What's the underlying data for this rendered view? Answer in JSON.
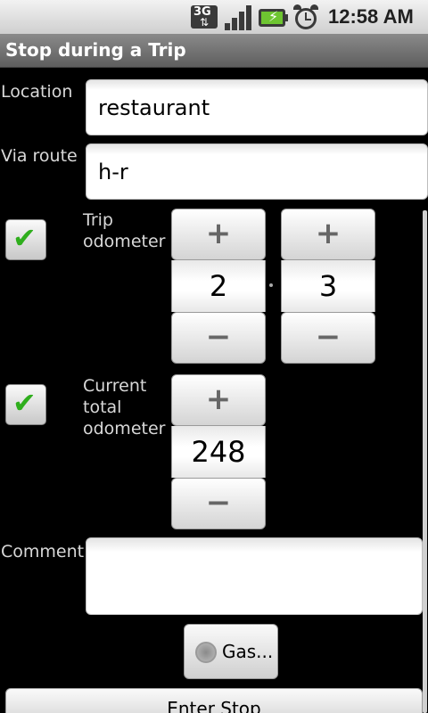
{
  "status_bar": {
    "network_label": "3G",
    "time": "12:58 AM",
    "icons": [
      "3g-icon",
      "signal-icon",
      "battery-charging-icon",
      "alarm-icon"
    ]
  },
  "header": {
    "title": "Stop during a Trip"
  },
  "form": {
    "location": {
      "label": "Location",
      "value": "restaurant"
    },
    "via_route": {
      "label": "Via route",
      "value": "h-r"
    },
    "trip_odometer": {
      "label_line1": "Trip",
      "label_line2": "odometer",
      "checked": true,
      "whole_value": "2",
      "separator": ".",
      "tenths_value": "3"
    },
    "total_odometer": {
      "label_line1": "Current",
      "label_line2": "total",
      "label_line3": "odometer",
      "checked": true,
      "value": "248"
    },
    "comment": {
      "label": "Comment",
      "value": ""
    },
    "gas_button": {
      "label": "Gas...",
      "checked": false
    },
    "enter_button": {
      "label": "Enter Stop"
    }
  },
  "stepper": {
    "plus": "+",
    "minus": "−"
  },
  "colors": {
    "check": "#2fae1d",
    "title_bar": "#6e6e6e",
    "background": "#000000"
  }
}
